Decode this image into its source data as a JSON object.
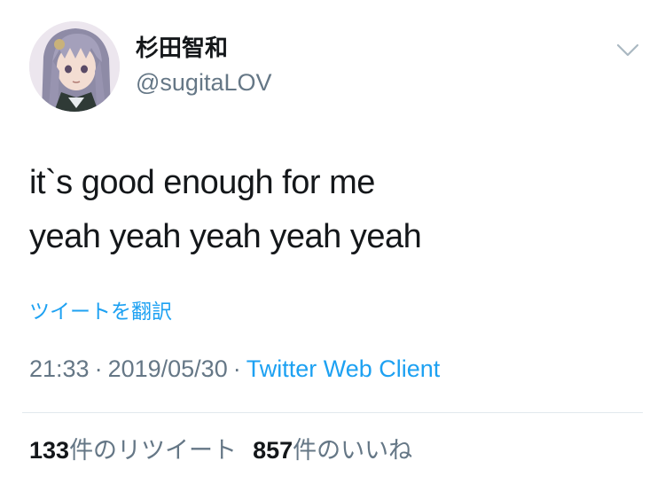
{
  "author": {
    "display_name": "杉田智和",
    "handle": "@sugitaLOV",
    "avatar_icon": "anime-character-avatar"
  },
  "menu": {
    "icon": "chevron-down-icon"
  },
  "tweet": {
    "lines": [
      "it`s good enough for me",
      "yeah yeah yeah yeah yeah"
    ],
    "translate_label": "ツイートを翻訳"
  },
  "meta": {
    "time": "21:33",
    "separator1": "·",
    "date": "2019/05/30",
    "separator2": "·",
    "client": "Twitter Web Client"
  },
  "stats": {
    "retweets_count": "133",
    "retweets_label": "件のリツイート",
    "likes_count": "857",
    "likes_label": "件のいいね"
  },
  "colors": {
    "link": "#1da1f2",
    "secondary_text": "#657786",
    "primary_text": "#14171a",
    "divider": "#e1e8ed"
  }
}
